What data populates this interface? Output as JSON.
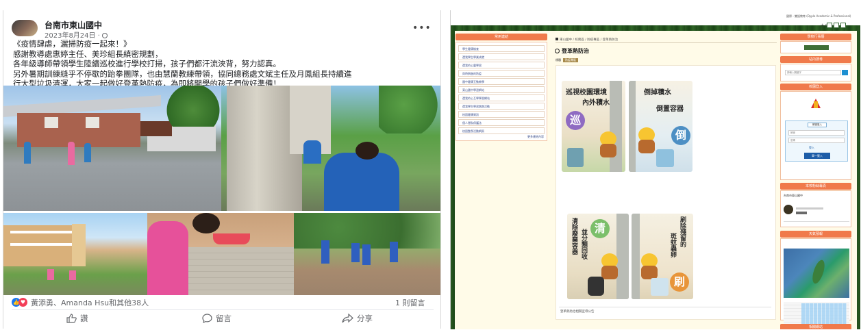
{
  "post": {
    "page_name": "台南市東山國中",
    "date": "2023年8月24日",
    "privacy_icon": "globe-icon",
    "more_label": "•••",
    "text": "《疫情肆虐，灑掃防疫一起來！》\n感謝教導處惠婷主任、美珍組長縝密規劃，\n各年級導師帶領學生陸續巡校進行學校打掃，孩子們都汗流浹背，努力認真。\n另外暑期訓練縫乎不停歇的跆拳團隊，也由慧蘭教練帶領，協同總務處文斌主任及月鳳組長持續進\n行大型垃圾清運，大家一起做好登革熱防疫，為即將開學的孩子們做好準備！",
    "reactions_text": "黃添勇、Amanda Hsu和其他38人",
    "comment_count": "1 則留言",
    "actions": {
      "like": "讚",
      "comment": "留言",
      "share": "分享"
    }
  },
  "site": {
    "site_name": "國際・雙語教育 (Dyple Academic & Professional)",
    "font_size": "大 中 小",
    "left_nav_title": "常用連結",
    "left_nav_items": [
      "學生健康檢查",
      "還我學生學業成就",
      "還我的心靈學習",
      "與時俱進的防疫",
      "國中健康互動教學",
      "東山國中學習網站",
      "還我的心互學學習網站",
      "還我學生學習跑跑活動",
      "校園健康資訊",
      "個人隱私保護法",
      "校園整潔活動網頁"
    ],
    "left_nav_more": "更多連結內容",
    "breadcrumb": "東山國中 / 校務區 / 防疫專區 / 登革熱防治",
    "page_title": "登革熱防治",
    "tags_label": "標題",
    "tag": "防疫專區",
    "posters": {
      "p1_text_1": "巡視校園環境",
      "p1_text_2": "內外積水",
      "p1_badge": "巡",
      "p2_text_1": "倒掉積水",
      "p2_text_2": "倒置容器",
      "p2_badge": "倒",
      "p3_text_1": "清除廢棄容器",
      "p3_text_2": "並分類回收",
      "p3_badge": "清",
      "p4_text_1": "刷除殘留的",
      "p4_text_2": "斑蚊蟲卵",
      "p4_badge": "刷"
    },
    "footnote": "登革熱防治相關宣導公告",
    "side": {
      "box1_title": "學校行事曆",
      "box2_title": "站內搜尋",
      "search_placeholder": "請輸入關鍵字",
      "box3_title": "校園登入",
      "login_title": "帳號登入",
      "login_user": "帳號",
      "login_pass": "密碼",
      "login_button_1": "登入",
      "login_button_2": "單一簽入",
      "box4_title": "本校粉絲專頁",
      "fb_name": "台南市東山國中",
      "box5_title": "天氣預報",
      "box6_title": "相關網站"
    }
  }
}
